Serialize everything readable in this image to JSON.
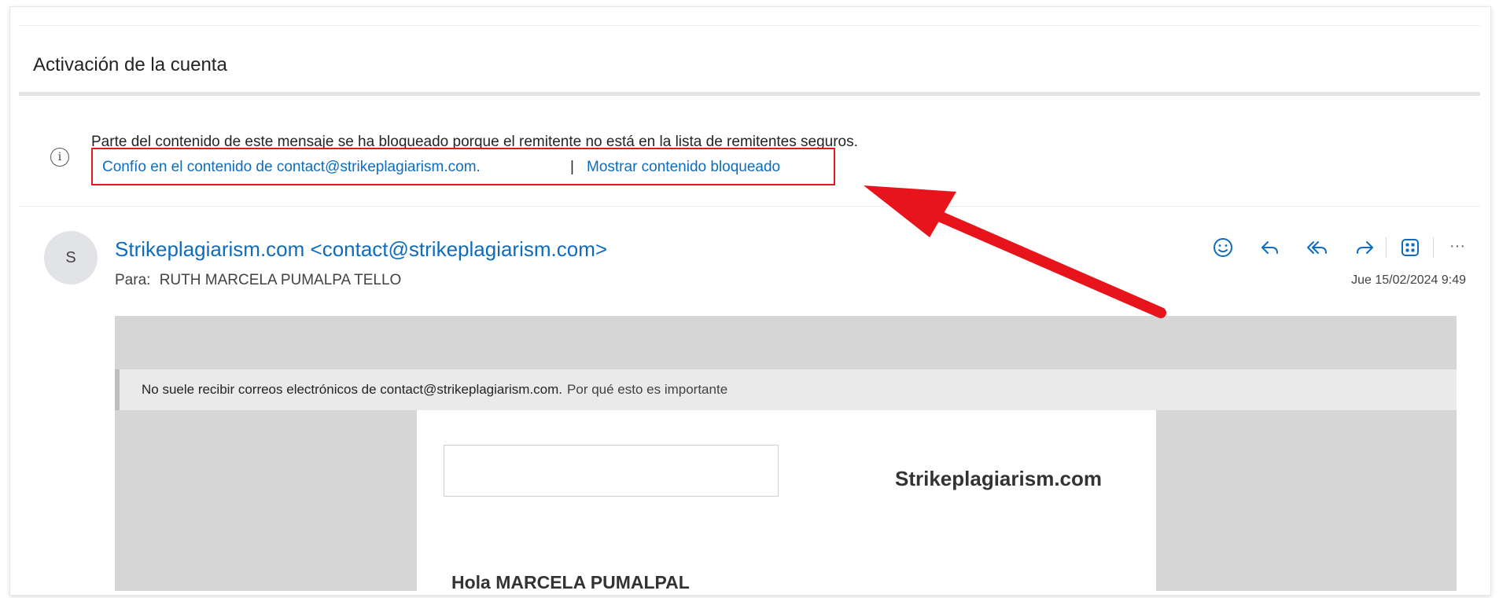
{
  "message": {
    "subject": "Activación de la cuenta",
    "blocked_notice": "Parte del contenido de este mensaje se ha bloqueado porque el remitente no está en la lista de remitentes seguros.",
    "trust_link": "Confío en el contenido de contact@strikeplagiarism.com.",
    "separator": "|",
    "show_blocked_link": "Mostrar contenido bloqueado",
    "avatar_initial": "S",
    "sender": "Strikeplagiarism.com <contact@strikeplagiarism.com>",
    "to_label": "Para:",
    "to_name": "RUTH MARCELA PUMALPA TELLO",
    "date": "Jue 15/02/2024 9:49",
    "more_label": "···"
  },
  "body": {
    "notice_text": "No suele recibir correos electrónicos de contact@strikeplagiarism.com.",
    "notice_link": "Por qué esto es importante",
    "brand": "Strikeplagiarism.com",
    "greeting": "Hola MARCELA PUMALPAL"
  },
  "colors": {
    "link": "#0f6cbd",
    "highlight": "#e0191f",
    "arrow": "#e8141c"
  },
  "icons": [
    "info-icon",
    "emoji-icon",
    "reply-icon",
    "reply-all-icon",
    "forward-icon",
    "apps-icon",
    "more-icon"
  ]
}
